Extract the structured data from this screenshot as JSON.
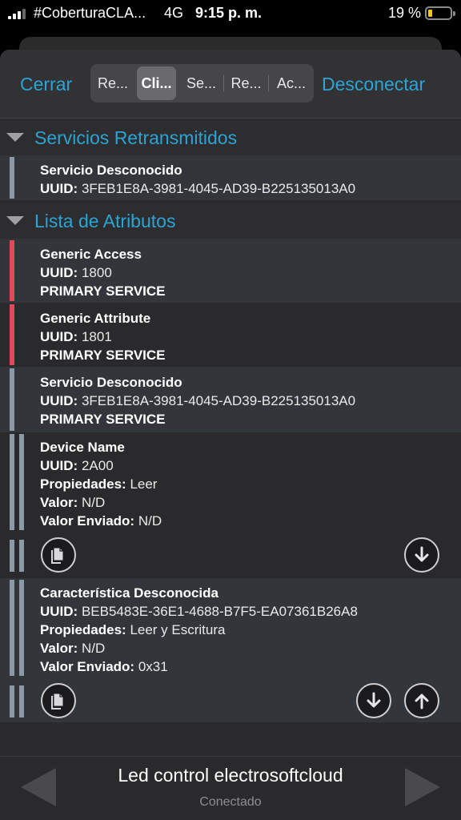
{
  "status_bar": {
    "carrier": "#CoberturaCLA...",
    "network": "4G",
    "time": "9:15 p. m.",
    "battery_percent": "19 %",
    "battery_level": 0.19
  },
  "nav": {
    "close_label": "Cerrar",
    "disconnect_label": "Desconectar",
    "segments": [
      "Re...",
      "Cli...",
      "Se...",
      "Re...",
      "Ac..."
    ],
    "active_segment": 1
  },
  "sections": {
    "retransmitted_title": "Servicios Retransmitidos",
    "attributes_title": "Lista de Atributos"
  },
  "labels": {
    "uuid": "UUID:",
    "properties": "Propiedades:",
    "value": "Valor:",
    "sent_value": "Valor Enviado:"
  },
  "retransmitted": [
    {
      "name": "Servicio Desconocido",
      "uuid": "3FEB1E8A-3981-4045-AD39-B225135013A0"
    }
  ],
  "attributes": [
    {
      "name": "Generic Access",
      "uuid": "1800",
      "type": "PRIMARY SERVICE"
    },
    {
      "name": "Generic Attribute",
      "uuid": "1801",
      "type": "PRIMARY SERVICE"
    },
    {
      "name": "Servicio Desconocido",
      "uuid": "3FEB1E8A-3981-4045-AD39-B225135013A0",
      "type": "PRIMARY SERVICE"
    }
  ],
  "characteristics": [
    {
      "name": "Device Name",
      "uuid": "2A00",
      "properties": "Leer",
      "value": "N/D",
      "sent_value": "N/D"
    },
    {
      "name": "Característica Desconocida",
      "uuid": "BEB5483E-36E1-4688-B7F5-EA07361B26A8",
      "properties": "Leer y Escritura",
      "value": "N/D",
      "sent_value": "0x31"
    }
  ],
  "footer": {
    "device_name": "Led control electrosoftcloud",
    "status": "Conectado"
  },
  "colors": {
    "accent": "#2ba4d4",
    "service_bar": "#e0485b",
    "custom_bar": "#8c9aa6"
  }
}
